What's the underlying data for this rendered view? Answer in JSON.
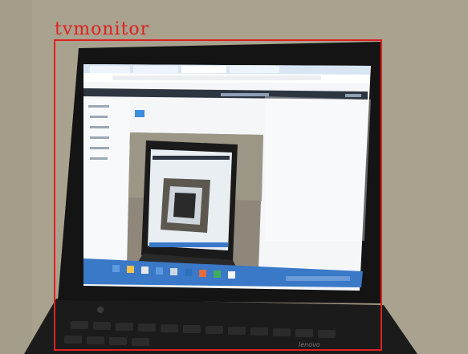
{
  "photo": {
    "subject": "laptop-screen-photo"
  },
  "detection": {
    "label": "tvmonitor",
    "box_color": "#e02020"
  },
  "screen_text": {
    "brand": "lenovo"
  },
  "colors": {
    "wall": "#a9a28e",
    "bezel": "#141414",
    "screen": "#f4f6f8",
    "tab_bar": "#d8e6f4",
    "app_header": "#2d3540",
    "taskbar": "#3a78c8"
  }
}
